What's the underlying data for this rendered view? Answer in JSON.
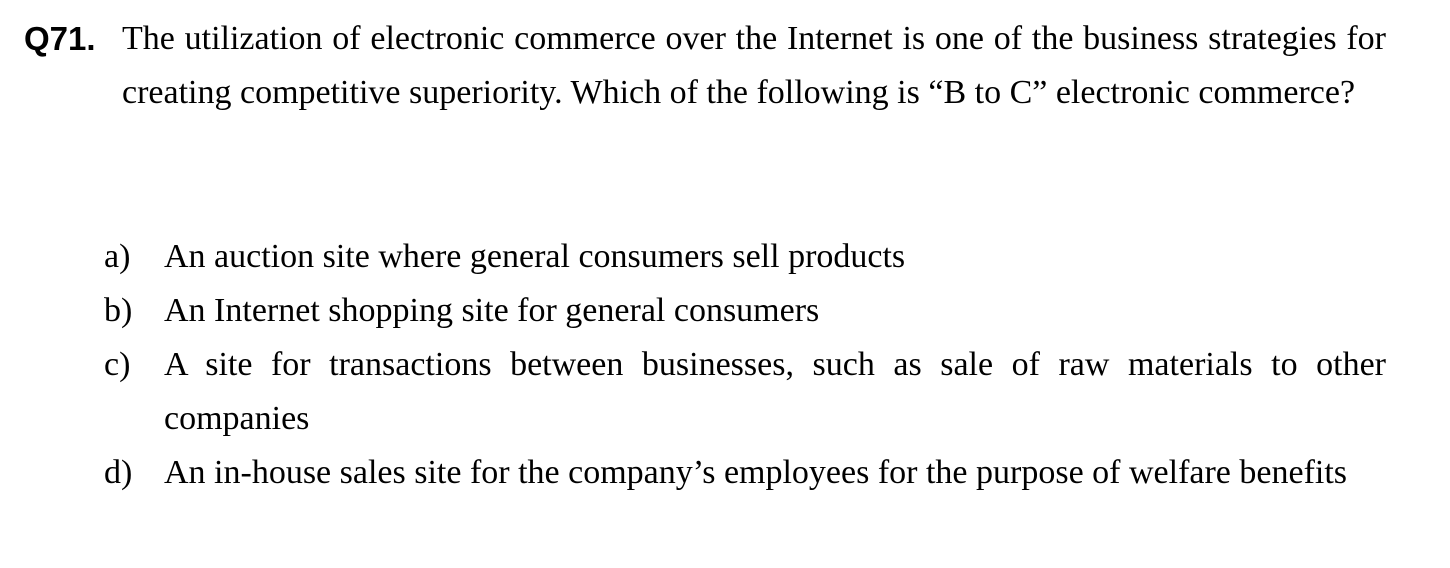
{
  "question": {
    "number": "Q71.",
    "text": "The utilization of electronic commerce over the Internet is one of the business strategies for creating competitive superiority.  Which of the following is “B to C” electronic commerce?"
  },
  "options": [
    {
      "letter": "a)",
      "text": "An auction site where general consumers sell products"
    },
    {
      "letter": "b)",
      "text": "An Internet shopping site for general consumers"
    },
    {
      "letter": "c)",
      "text": "A site for transactions between businesses, such as sale of raw materials to other companies"
    },
    {
      "letter": "d)",
      "text": "An in-house sales site for the company’s employees for the purpose of welfare benefits"
    }
  ]
}
